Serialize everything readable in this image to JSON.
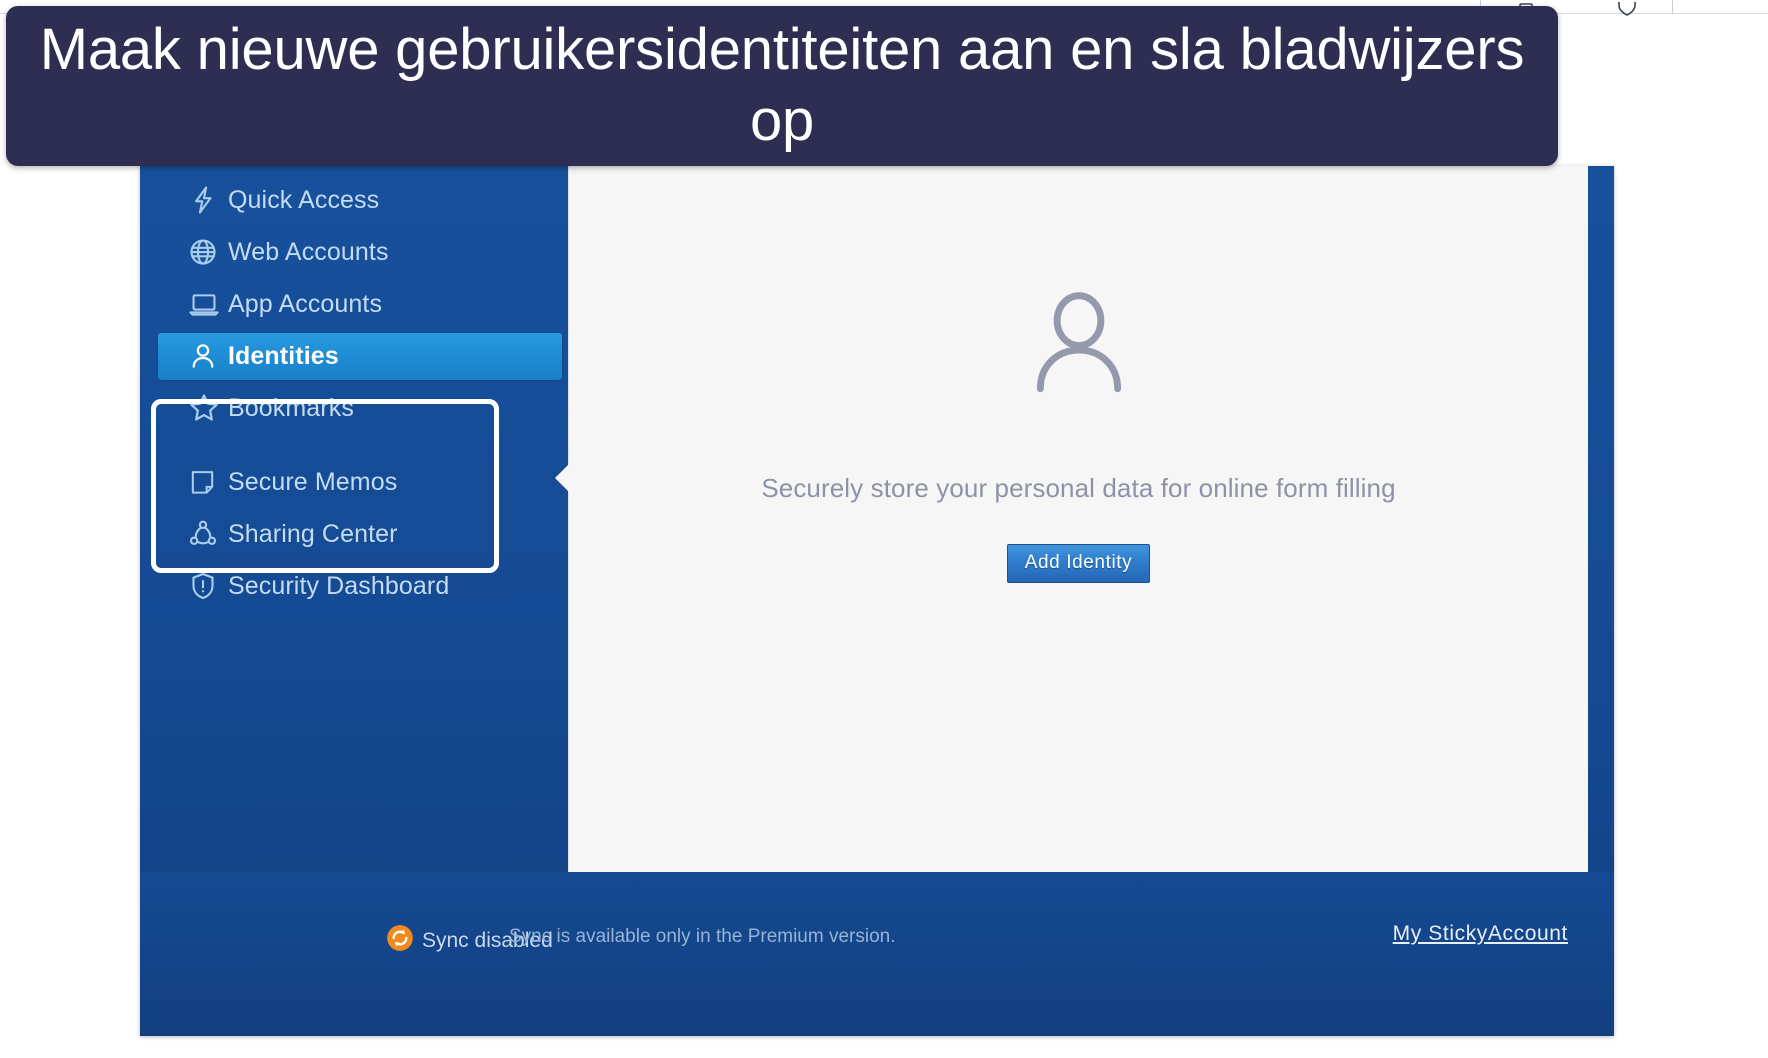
{
  "banner": {
    "text": "Maak nieuwe gebruikersidentiteiten aan en sla bladwijzers op",
    "background_color": "#2e2e52",
    "text_color": "#ffffff"
  },
  "toolbar": {
    "icons": [
      "bookmark-icon",
      "shield-icon"
    ]
  },
  "sidebar": {
    "background_color": "#154a93",
    "active_color": "#1f8ed6",
    "items": [
      {
        "label": "Quick Access",
        "icon": "lightning-bolt-icon",
        "active": false
      },
      {
        "label": "Web Accounts",
        "icon": "globe-icon",
        "active": false
      },
      {
        "label": "App Accounts",
        "icon": "laptop-icon",
        "active": false
      },
      {
        "label": "Identities",
        "icon": "person-icon",
        "active": true
      },
      {
        "label": "Bookmarks",
        "icon": "star-icon",
        "active": false
      },
      {
        "label": "Secure Memos",
        "icon": "note-icon",
        "active": false
      },
      {
        "label": "Sharing Center",
        "icon": "share-nodes-icon",
        "active": false
      },
      {
        "label": "Security Dashboard",
        "icon": "shield-alert-icon",
        "active": false
      }
    ],
    "highlight_ring": {
      "items": [
        "Identities",
        "Bookmarks"
      ],
      "color": "#ffffff"
    }
  },
  "main": {
    "illustration_icon": "person-outline-icon",
    "empty_message": "Securely store your personal data for online form filling",
    "add_button_label": "Add Identity",
    "background_color": "#f6f6f7"
  },
  "footer": {
    "sync_icon": "sync-disabled-icon",
    "sync_icon_color": "#f08a1e",
    "sync_status": "Sync disabled",
    "premium_note": "Sync is available only in the Premium version.",
    "account_link": "My StickyAccount"
  }
}
